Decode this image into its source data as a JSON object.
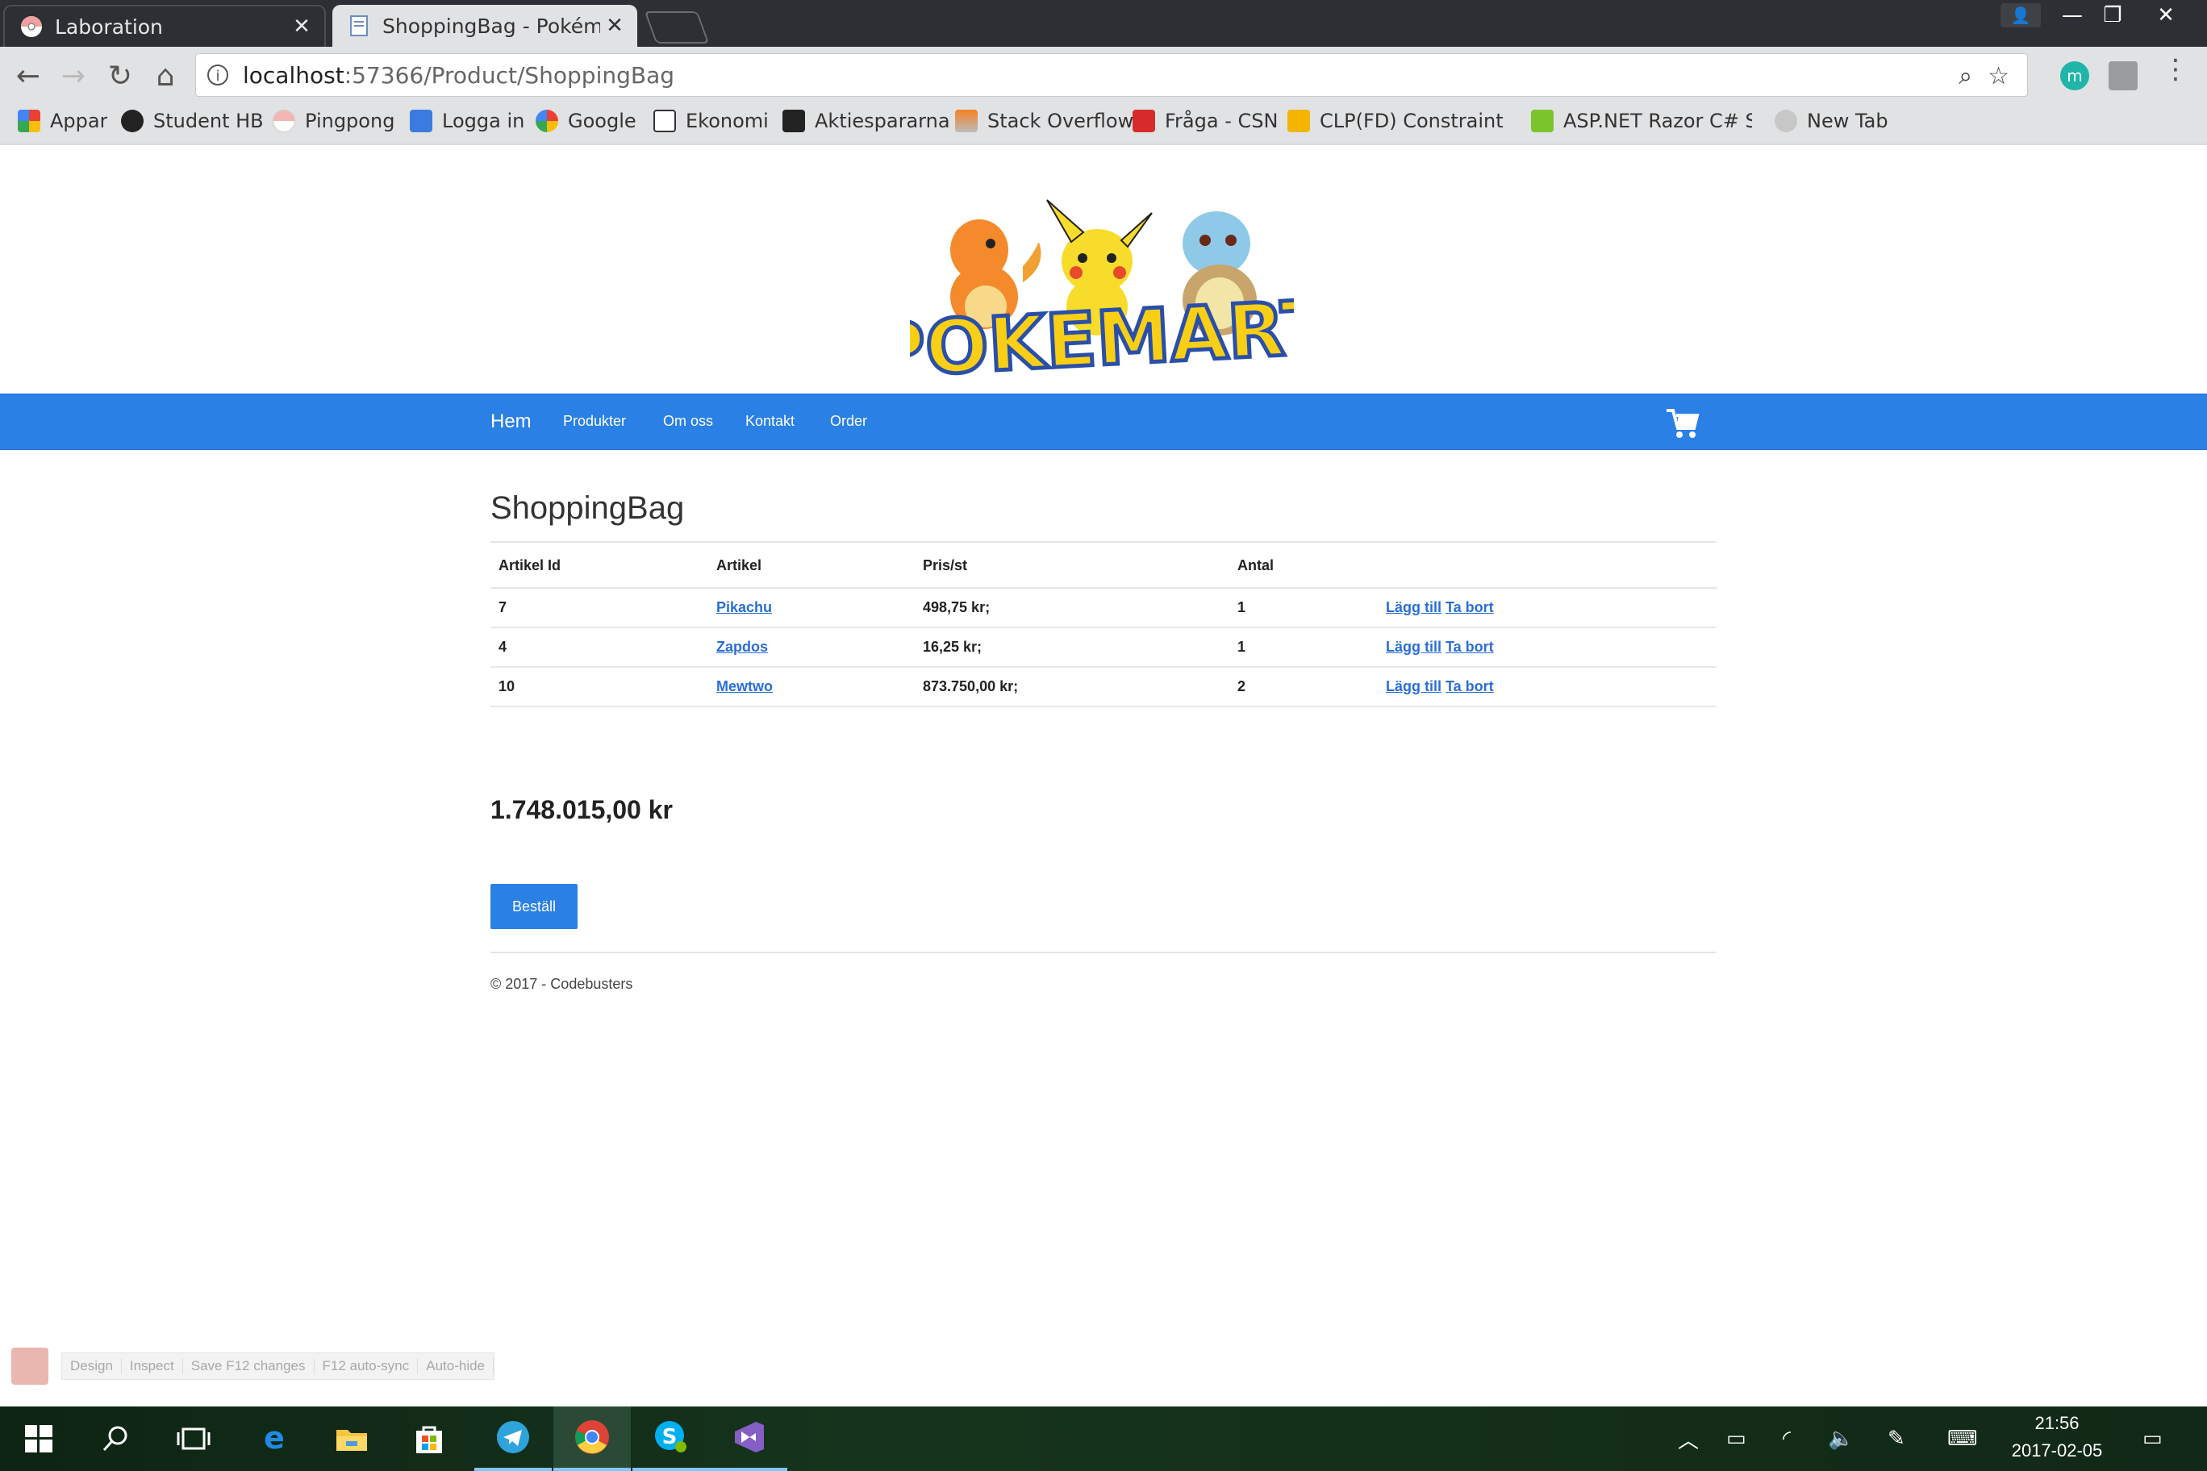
{
  "browser": {
    "tabs": [
      {
        "title": "Laboration",
        "active": false
      },
      {
        "title": "ShoppingBag - Pokémon",
        "active": true
      }
    ],
    "url_host": "localhost",
    "url_path": ":57366/Product/ShoppingBag",
    "bookmarks": [
      {
        "label": "Appar",
        "icon": "apps-grid-icon"
      },
      {
        "label": "Student HB",
        "icon": "student-hb-icon"
      },
      {
        "label": "Pingpong",
        "icon": "pokeball-icon"
      },
      {
        "label": "Logga in",
        "icon": "people-icon"
      },
      {
        "label": "Google",
        "icon": "google-icon"
      },
      {
        "label": "Ekonomi",
        "icon": "ekonomi-icon"
      },
      {
        "label": "Aktiespararna",
        "icon": "aktiespararna-icon"
      },
      {
        "label": "Stack Overflow",
        "icon": "stackoverflow-icon"
      },
      {
        "label": "Fråga - CSN",
        "icon": "csn-icon"
      },
      {
        "label": "CLP(FD) Constraint Lo",
        "icon": "clp-icon"
      },
      {
        "label": "ASP.NET Razor C# Syn",
        "icon": "asp-icon"
      },
      {
        "label": "New Tab",
        "icon": "newtab-icon"
      }
    ]
  },
  "site": {
    "logo_text": "POKEMART",
    "nav": {
      "brand": "Hem",
      "links": [
        "Produkter",
        "Om oss",
        "Kontakt",
        "Order"
      ]
    },
    "page_title": "ShoppingBag",
    "table": {
      "headers": [
        "Artikel Id",
        "Artikel",
        "Pris/st",
        "Antal",
        ""
      ],
      "rows": [
        {
          "id": "7",
          "name": "Pikachu",
          "price": "498,75 kr;",
          "qty": "1",
          "add": "Lägg till",
          "remove": "Ta bort"
        },
        {
          "id": "4",
          "name": "Zapdos",
          "price": "16,25 kr;",
          "qty": "1",
          "add": "Lägg till",
          "remove": "Ta bort"
        },
        {
          "id": "10",
          "name": "Mewtwo",
          "price": "873.750,00 kr;",
          "qty": "2",
          "add": "Lägg till",
          "remove": "Ta bort"
        }
      ]
    },
    "total": "1.748.015,00 kr",
    "order_button": "Beställ",
    "footer": "© 2017 - Codebusters"
  },
  "vs_toolbar": [
    "Design",
    "Inspect",
    "Save F12 changes",
    "F12 auto-sync",
    "Auto-hide"
  ],
  "taskbar": {
    "time": "21:56",
    "date": "2017-02-05"
  },
  "colors": {
    "navbar": "#2a80e4",
    "link": "#2a6fd6",
    "tab_active": "#e1e2e4",
    "titlebar": "#2c2f33"
  }
}
